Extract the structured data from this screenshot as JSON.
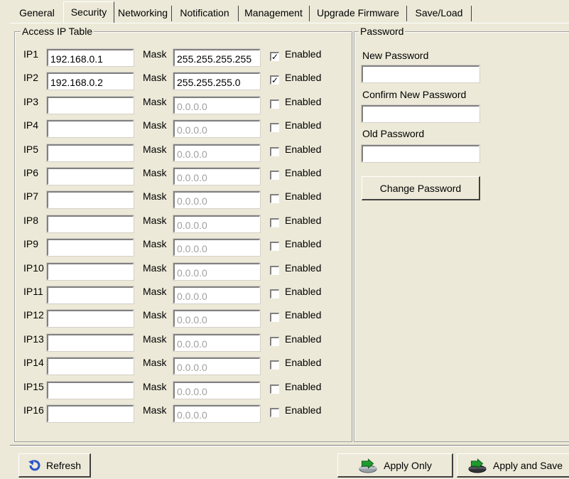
{
  "tabs": [
    "General",
    "Security",
    "Networking",
    "Notification",
    "Management",
    "Upgrade Firmware",
    "Save/Load"
  ],
  "active_tab": "Security",
  "access_table": {
    "title": "Access IP Table",
    "mask_label": "Mask",
    "enabled_label": "Enabled",
    "rows": [
      {
        "label": "IP1",
        "ip": "192.168.0.1",
        "mask": "255.255.255.255",
        "enabled": true
      },
      {
        "label": "IP2",
        "ip": "192.168.0.2",
        "mask": "255.255.255.0",
        "enabled": true
      },
      {
        "label": "IP3",
        "ip": "",
        "mask": "0.0.0.0",
        "enabled": false
      },
      {
        "label": "IP4",
        "ip": "",
        "mask": "0.0.0.0",
        "enabled": false
      },
      {
        "label": "IP5",
        "ip": "",
        "mask": "0.0.0.0",
        "enabled": false
      },
      {
        "label": "IP6",
        "ip": "",
        "mask": "0.0.0.0",
        "enabled": false
      },
      {
        "label": "IP7",
        "ip": "",
        "mask": "0.0.0.0",
        "enabled": false
      },
      {
        "label": "IP8",
        "ip": "",
        "mask": "0.0.0.0",
        "enabled": false
      },
      {
        "label": "IP9",
        "ip": "",
        "mask": "0.0.0.0",
        "enabled": false
      },
      {
        "label": "IP10",
        "ip": "",
        "mask": "0.0.0.0",
        "enabled": false
      },
      {
        "label": "IP11",
        "ip": "",
        "mask": "0.0.0.0",
        "enabled": false
      },
      {
        "label": "IP12",
        "ip": "",
        "mask": "0.0.0.0",
        "enabled": false
      },
      {
        "label": "IP13",
        "ip": "",
        "mask": "0.0.0.0",
        "enabled": false
      },
      {
        "label": "IP14",
        "ip": "",
        "mask": "0.0.0.0",
        "enabled": false
      },
      {
        "label": "IP15",
        "ip": "",
        "mask": "0.0.0.0",
        "enabled": false
      },
      {
        "label": "IP16",
        "ip": "",
        "mask": "0.0.0.0",
        "enabled": false
      }
    ]
  },
  "password": {
    "title": "Password",
    "new_label": "New Password",
    "new_value": "",
    "confirm_label": "Confirm New Password",
    "confirm_value": "",
    "old_label": "Old Password",
    "old_value": "",
    "change_button": "Change Password"
  },
  "footer": {
    "refresh_label": "Refresh",
    "apply_only_label": "Apply Only",
    "apply_save_label": "Apply and Save"
  },
  "icons": {
    "refresh": "refresh-arrow-icon",
    "apply_only": "apply-green-arrow-icon",
    "apply_save": "apply-save-disk-icon"
  }
}
